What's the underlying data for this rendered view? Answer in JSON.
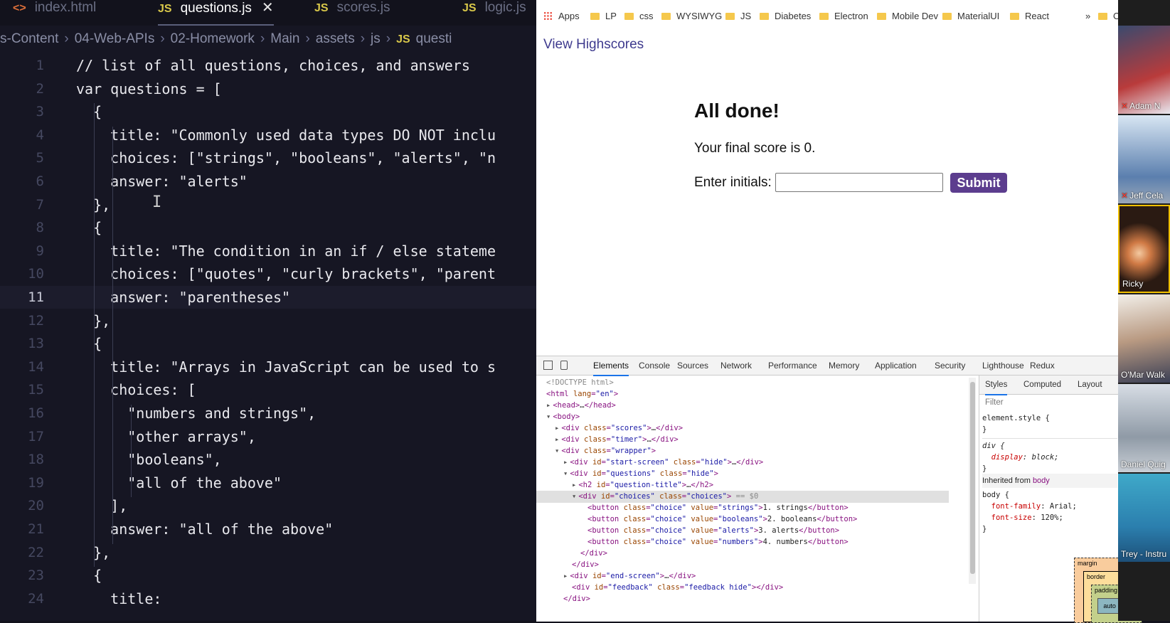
{
  "editor": {
    "tabs": [
      {
        "icon": "<>",
        "label": "index.html",
        "active": false
      },
      {
        "icon": "JS",
        "label": "questions.js",
        "active": true,
        "close": "✕"
      },
      {
        "icon": "JS",
        "label": "scores.js",
        "active": false
      },
      {
        "icon": "JS",
        "label": "logic.js",
        "active": false
      }
    ],
    "breadcrumb": [
      "s-Content",
      "04-Web-APIs",
      "02-Homework",
      "Main",
      "assets",
      "js",
      "questi"
    ],
    "breadcrumb_js_icon": "JS",
    "current_line": 11,
    "lines": [
      {
        "n": "1",
        "text": "// list of all questions, choices, and answers"
      },
      {
        "n": "2",
        "text": "var questions = ["
      },
      {
        "n": "3",
        "text": "  {"
      },
      {
        "n": "4",
        "text": "    title: \"Commonly used data types DO NOT inclu"
      },
      {
        "n": "5",
        "text": "    choices: [\"strings\", \"booleans\", \"alerts\", \"n"
      },
      {
        "n": "6",
        "text": "    answer: \"alerts\""
      },
      {
        "n": "7",
        "text": "  },"
      },
      {
        "n": "8",
        "text": "  {"
      },
      {
        "n": "9",
        "text": "    title: \"The condition in an if / else stateme"
      },
      {
        "n": "10",
        "text": "    choices: [\"quotes\", \"curly brackets\", \"parent"
      },
      {
        "n": "11",
        "text": "    answer: \"parentheses\""
      },
      {
        "n": "12",
        "text": "  },"
      },
      {
        "n": "13",
        "text": "  {"
      },
      {
        "n": "14",
        "text": "    title: \"Arrays in JavaScript can be used to s"
      },
      {
        "n": "15",
        "text": "    choices: ["
      },
      {
        "n": "16",
        "text": "      \"numbers and strings\","
      },
      {
        "n": "17",
        "text": "      \"other arrays\","
      },
      {
        "n": "18",
        "text": "      \"booleans\","
      },
      {
        "n": "19",
        "text": "      \"all of the above\""
      },
      {
        "n": "20",
        "text": "    ],"
      },
      {
        "n": "21",
        "text": "    answer: \"all of the above\""
      },
      {
        "n": "22",
        "text": "  },"
      },
      {
        "n": "23",
        "text": "  {"
      },
      {
        "n": "24",
        "text": "    title:"
      }
    ]
  },
  "browser": {
    "bookmarks": [
      "Apps",
      "LP",
      "css",
      "WYSIWYG",
      "JS",
      "Diabetes",
      "Electron",
      "Mobile Dev",
      "MaterialUI",
      "React"
    ],
    "bookmarks_overflow": "»",
    "bookmarks_other": "Other book",
    "page": {
      "view_highscores": "View Highscores",
      "title": "All done!",
      "final_score": "Your final score is 0.",
      "initials_label": "Enter initials:",
      "initials_value": "",
      "submit_label": "Submit"
    },
    "devtools": {
      "tabs": [
        "Elements",
        "Console",
        "Sources",
        "Network",
        "Performance",
        "Memory",
        "Application",
        "Security",
        "Lighthouse",
        "Redux"
      ],
      "active_tab": "Elements",
      "styles_tabs": [
        "Styles",
        "Computed",
        "Layout"
      ],
      "styles_filter_placeholder": "Filter",
      "inherited_from_label": "Inherited from",
      "inherited_from_tag": "body",
      "box_model": {
        "margin": "margin",
        "margin_value": "–",
        "border": "border",
        "border_value": "–",
        "padding": "padding",
        "padding_value": "–",
        "content": "auto × auto"
      }
    }
  },
  "participants": [
    "Adam N",
    "Jeff Cela",
    "Ricky",
    "O'Mar Walk",
    "Daniel Quig",
    "Trey - Instru"
  ],
  "colors": {
    "accent_purple": "#5c3d8e",
    "link_blue": "#3e3a8e",
    "devtools_active": "#1a73e8"
  }
}
